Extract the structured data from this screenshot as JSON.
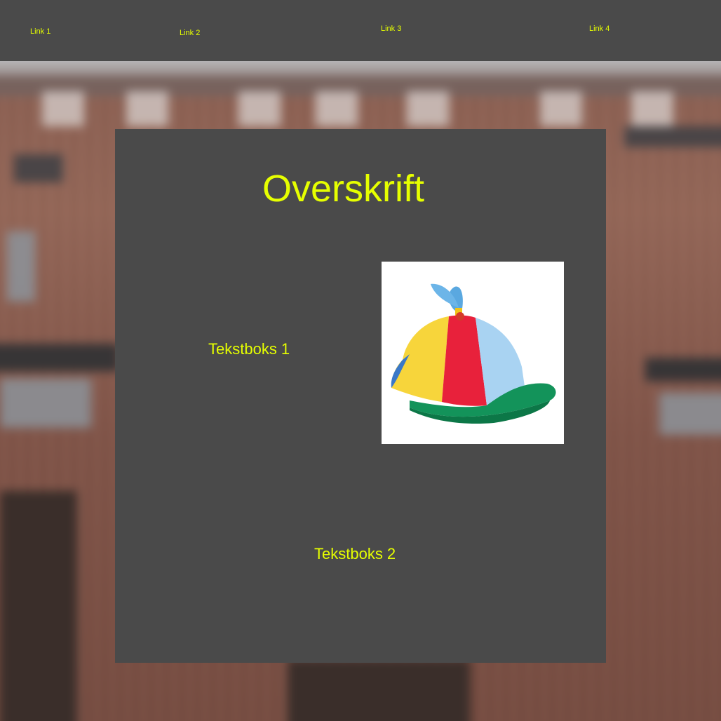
{
  "nav": {
    "links": [
      "Link 1",
      "Link 2",
      "Link 3",
      "Link 4"
    ]
  },
  "main": {
    "headline": "Overskrift",
    "textbox_1": "Tekstboks 1",
    "textbox_2": "Tekstboks 2",
    "image": {
      "icon": "propeller-cap-image"
    }
  },
  "colors": {
    "accent_text": "#e6ff00",
    "panel_bg": "#4a4a4a",
    "nav_bg": "#4a4a4a"
  }
}
